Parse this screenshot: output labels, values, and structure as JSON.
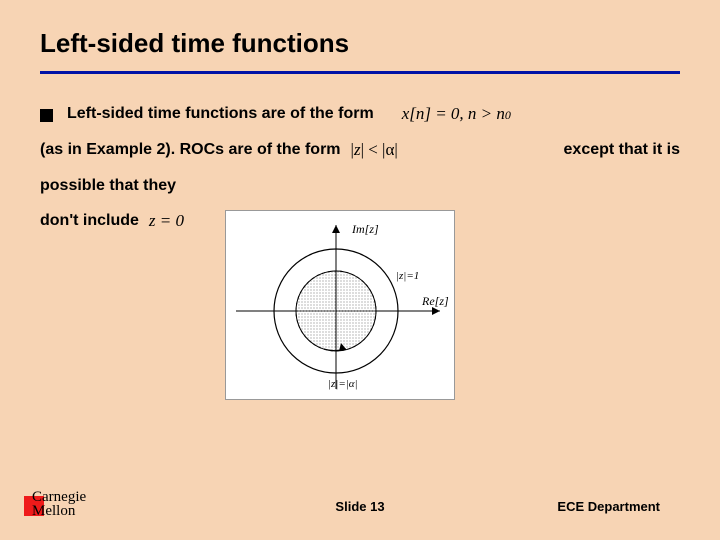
{
  "title": "Left-sided time functions",
  "bullet": {
    "line1_text": "Left-sided time functions are of the form",
    "line1_math": "x[n] = 0, n > n",
    "line1_math_sub": "0",
    "line2_left": "(as in Example 2).  ROCs are of the form",
    "line2_math_l": "|",
    "line2_math_z": "z",
    "line2_math_m": "| < |α|",
    "line2_right": "except that it is",
    "line3": "possible that they",
    "line4_text": "don't include",
    "line4_math": "z = 0"
  },
  "diagram": {
    "im_label": "Im[z]",
    "re_label": "Re[z]",
    "unit_label": "|z|=1",
    "alpha_label": "|z|=|α|"
  },
  "footer": {
    "logo_top": "Carnegie",
    "logo_bottom": "Mellon",
    "slide": "Slide 13",
    "dept": "ECE Department"
  }
}
